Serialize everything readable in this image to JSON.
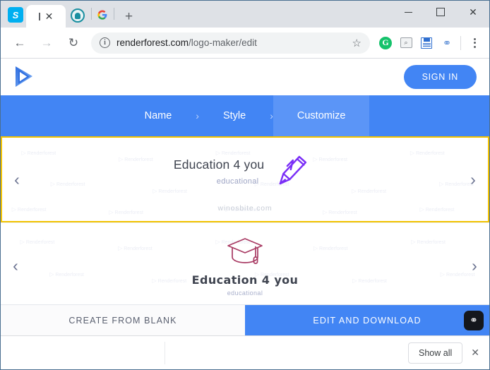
{
  "browser": {
    "tabs": [
      {
        "favicon": "skype-icon",
        "title": ""
      },
      {
        "favicon": "loading-icon",
        "title": "",
        "active": true,
        "close_label": "✕"
      },
      {
        "favicon": "avatar-icon",
        "title": ""
      },
      {
        "favicon": "google-icon",
        "title": ""
      }
    ],
    "new_tab_label": "+",
    "window_controls": {
      "minimize": "–",
      "maximize": "□",
      "close": "✕"
    },
    "nav": {
      "back": "←",
      "forward": "→",
      "reload": "↻"
    },
    "omnibox": {
      "site_info_icon": "info-icon",
      "site_info_glyph": "i",
      "domain": "renderforest.com",
      "path": "/logo-maker/edit",
      "bookmark_glyph": "☆"
    },
    "extensions": [
      {
        "name": "grammarly-extension-icon",
        "glyph": "G"
      },
      {
        "name": "search-extension-icon",
        "glyph": "⌕"
      },
      {
        "name": "save-page-extension-icon",
        "glyph": ""
      },
      {
        "name": "link-extension-icon",
        "glyph": "⚭"
      }
    ],
    "menu_label": "⋮"
  },
  "site": {
    "logo_name": "renderforest-logo",
    "signin_label": "SIGN IN",
    "steps": [
      {
        "label": "Name",
        "active": false
      },
      {
        "label": "Style",
        "active": false
      },
      {
        "label": "Customize",
        "active": true
      }
    ],
    "step_separator": "›"
  },
  "logos": {
    "prev_arrow": "‹",
    "next_arrow": "›",
    "watermark_text": "Renderforest",
    "cards": [
      {
        "selected": true,
        "title": "Education  4 you",
        "tagline": "educational",
        "icon": "pencil-icon",
        "icon_color": "#7b2ff7",
        "site_watermark": "winosbite.com"
      },
      {
        "selected": false,
        "title": "Education  4 you",
        "tagline": "educational",
        "icon": "graduation-cap-icon",
        "icon_color": "#a83a63"
      }
    ]
  },
  "actions": {
    "create_blank_label": "CREATE FROM BLANK",
    "edit_download_label": "EDIT AND DOWNLOAD",
    "floating_extension_icon": "link-badge-icon",
    "floating_extension_glyph": "⚭"
  },
  "download_shelf": {
    "show_all_label": "Show all",
    "close_glyph": "✕"
  }
}
